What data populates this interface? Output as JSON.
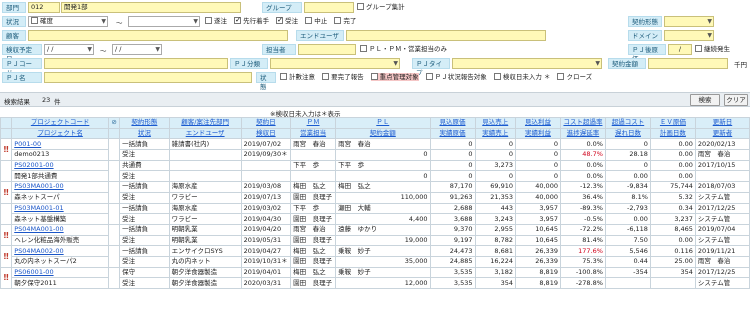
{
  "form": {
    "dept_label": "部門",
    "dept_code": "012",
    "dept_name": "開発1部",
    "group_label": "グループ",
    "group_total": "グループ集計",
    "status_label": "状況",
    "status_items": [
      "確度",
      "～",
      "",
      "遂注",
      "先行着手",
      "受注",
      "中止",
      "完了"
    ],
    "status_checked": [
      false,
      false,
      false,
      false,
      true,
      true,
      false,
      false
    ],
    "contract_type_label": "契約形態",
    "customer_label": "顧客",
    "end_user_label": "エンドユーザ",
    "domain_label": "ドメイン",
    "inspection_label": "検収予定日",
    "date_from": "/ /",
    "tilde": "～",
    "date_to": "/ /",
    "manager_label": "担当者",
    "pl_pm_label": "ＰＬ・ＰＭ・営業担当のみ",
    "pj_issue_label": "ＰＪ後原価",
    "pj_issue_value": "/",
    "continuing_label": "継続発生",
    "pj_code_label": "ＰＪコード",
    "pj_category_label": "ＰＪ分類",
    "pj_type_label": "ＰＪタイプ",
    "contract_amount_label": "契約金額",
    "thousand_label": "千円",
    "pj_name_label": "ＰＪ名",
    "state_label": "状態",
    "state_items": [
      "計數注意",
      "要完了報告",
      "重点管理対象",
      "ＰＪ状況報告対象",
      "検収日未入力 ＊",
      "クローズ"
    ],
    "state_checked": [
      false,
      false,
      false,
      false,
      false,
      false
    ]
  },
  "results": {
    "label": "検索結果",
    "count": "23",
    "unit": "件",
    "search_button": "検索",
    "clear_button": "クリア",
    "note": "※検収日未入力は＊表示"
  },
  "table": {
    "header1": [
      "プロジェクトコード",
      "",
      "契約形態",
      "顧客/案注先部門",
      "契約日",
      "ＰＭ",
      "ＰＬ",
      "",
      "見込原価",
      "見込売上",
      "見込利益",
      "コスト超過率",
      "超過コスト",
      "ＥＶ原価",
      "更新日"
    ],
    "header2": [
      "プロジェクト名",
      "",
      "状況",
      "エンドユーザ",
      "検収日",
      "営業担当",
      "契約金額",
      "",
      "実績原価",
      "実績売上",
      "実績利益",
      "進捗遅延率",
      "遅れ日数",
      "計画日数",
      "更新者"
    ],
    "rows": [
      {
        "code": "P001-00",
        "name": "demo0213",
        "ctype": "一括請負",
        "status": "受注",
        "cust": "雑請書(社内)",
        "euser": "",
        "cdate": "2019/07/02",
        "idate": "2019/09/30＊",
        "pm": "雨宮　春治",
        "sales": "",
        "pl": "雨宮　春治",
        "amount": "0",
        "c1": "0",
        "c2": "0",
        "c3": "0",
        "c4": "0",
        "c5": "0",
        "c6": "0.0%",
        "c7": "48.7%",
        "c8": "0",
        "c9": "28.18",
        "c10": "0.00",
        "c11": "0.00",
        "c12": "2020/02/13",
        "c13": "雨宮　春治",
        "warn": true,
        "red7": true
      },
      {
        "code": "PS02001-00",
        "name": "開発1部共通費",
        "ctype": "共通費",
        "status": "受注",
        "cust": "",
        "euser": "",
        "cdate": "",
        "idate": "",
        "pm": "下平　歩",
        "sales": "",
        "pl": "下平　歩",
        "amount": "0",
        "c1": "0",
        "c2": "3,273",
        "c3": "0",
        "c4": "0",
        "c5": "0",
        "c6": "0.0%",
        "c7": "0.0%",
        "c8": "0",
        "c9": "0.00",
        "c10": "0.00",
        "c11": "0.00",
        "c12": "2017/10/15",
        "c13": "",
        "warn": false,
        "red7": false
      },
      {
        "code": "PS03MA001-00",
        "name": "森ネットスーパ",
        "ctype": "一括請負",
        "status": "受注",
        "cust": "海原水産",
        "euser": "ワラビー",
        "cdate": "2019/03/08",
        "idate": "2019/07/13",
        "pm": "梅田　弘之",
        "sales": "園田　良理子",
        "pl": "梅田　弘之",
        "amount": "110,000",
        "c1": "87,170",
        "c2": "69,910",
        "c3": "40,000",
        "c4": "91,263",
        "c5": "21,353",
        "c6": "-12.3%",
        "c7": "36.4%",
        "c8": "-9,834",
        "c9": "8.1%",
        "c10": "75,744",
        "c11": "5.32",
        "c12": "2018/07/03",
        "c13": "システム管",
        "warn": true,
        "red7": false
      },
      {
        "code": "PS03MA001-01",
        "name": "森ネット基盤構築",
        "ctype": "一括請負",
        "status": "受注",
        "cust": "海原水産",
        "euser": "ワラビー",
        "cdate": "2019/03/02",
        "idate": "2019/04/30",
        "pm": "下平　歩",
        "sales": "園田　良理子",
        "pl": "瀬田　大輔",
        "amount": "4,400",
        "c1": "2,688",
        "c2": "443",
        "c3": "3,957",
        "c4": "3,688",
        "c5": "3,243",
        "c6": "-89.3%",
        "c7": "-0.5%",
        "c8": "-2,793",
        "c9": "0.00",
        "c10": "0.34",
        "c11": "3,237",
        "c12": "2017/12/25",
        "c13": "システム管",
        "warn": false,
        "red7": false
      },
      {
        "code": "PS04MA001-00",
        "name": "ヘレン化粧品海外販売",
        "ctype": "一括請負",
        "status": "受注",
        "cust": "明朝乳業",
        "euser": "明朝乳業",
        "cdate": "2019/04/20",
        "idate": "2019/05/31",
        "pm": "雨宮　春治",
        "sales": "園田　良理子",
        "pl": "遠藤　ゆかり",
        "amount": "19,000",
        "c1": "9,370",
        "c2": "2,955",
        "c3": "10,645",
        "c4": "9,197",
        "c5": "8,782",
        "c6": "-72.2%",
        "c7": "81.4%",
        "c8": "-6,118",
        "c9": "7.50",
        "c10": "8,465",
        "c11": "0.00",
        "c12": "2019/07/04",
        "c13": "システム管",
        "warn": true,
        "red7": false
      },
      {
        "code": "PS04MA002-00",
        "name": "丸の内ネットスーパ2",
        "ctype": "一括請負",
        "status": "受注",
        "cust": "エンサイクロSYS",
        "euser": "丸の内ネット",
        "cdate": "2019/04/27",
        "idate": "2019/10/31＊",
        "pm": "梅田　弘之",
        "sales": "園田　良理子",
        "pl": "乗鞍　妙子",
        "amount": "35,000",
        "c1": "24,473",
        "c2": "8,681",
        "c3": "26,339",
        "c4": "24,885",
        "c5": "16,224",
        "c6": "177.6%",
        "c7": "75.3%",
        "c8": "5,546",
        "c9": "0.44",
        "c10": "0.116",
        "c11": "25.00",
        "c12": "2019/11/21",
        "c13": "雨宮　春治",
        "warn": true,
        "red7": false,
        "red6": true
      },
      {
        "code": "PS06001-00",
        "name": "朝夕保守2011",
        "ctype": "保守",
        "status": "受注",
        "cust": "朝夕洋食器製造",
        "euser": "朝夕洋食器製造",
        "cdate": "2019/04/01",
        "idate": "2020/03/31",
        "pm": "梅田　弘之",
        "sales": "園田　良理子",
        "pl": "乗鞍　妙子",
        "amount": "12,000",
        "c1": "3,535",
        "c2": "3,182",
        "c3": "8,819",
        "c4": "3,535",
        "c5": "354",
        "c6": "-100.8%",
        "c7": "-278.8%",
        "c8": "-354",
        "c9": "",
        "c10": "354",
        "c11": "",
        "c12": "2017/12/25",
        "c13": "システム管",
        "warn": true,
        "red7": false
      }
    ]
  }
}
